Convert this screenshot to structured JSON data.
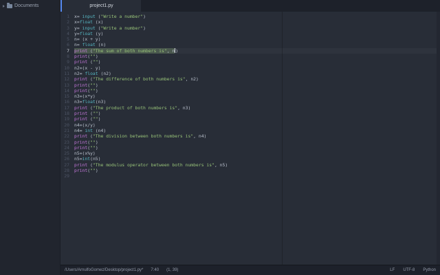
{
  "sidebar": {
    "items": [
      {
        "label": "Documents",
        "icon": "folder-icon",
        "state": "collapsed"
      }
    ]
  },
  "tabbar": {
    "tabs": [
      {
        "label": "project1.py",
        "active": true
      }
    ]
  },
  "editor": {
    "wrap_guide_column": 80,
    "active_line": 7,
    "lines": [
      {
        "num": 1,
        "tokens": [
          {
            "t": "plain",
            "s": "x= "
          },
          {
            "t": "fn",
            "s": "input"
          },
          {
            "t": "plain",
            "s": " ("
          },
          {
            "t": "str",
            "s": "\"Write a number\""
          },
          {
            "t": "plain",
            "s": ")"
          }
        ]
      },
      {
        "num": 2,
        "tokens": [
          {
            "t": "plain",
            "s": "x="
          },
          {
            "t": "fn",
            "s": "float"
          },
          {
            "t": "plain",
            "s": " (x)"
          }
        ]
      },
      {
        "num": 3,
        "tokens": [
          {
            "t": "plain",
            "s": "y= "
          },
          {
            "t": "fn",
            "s": "input"
          },
          {
            "t": "plain",
            "s": " ("
          },
          {
            "t": "str",
            "s": "\"Write a number\""
          },
          {
            "t": "plain",
            "s": ")"
          }
        ]
      },
      {
        "num": 4,
        "tokens": [
          {
            "t": "plain",
            "s": "y="
          },
          {
            "t": "fn",
            "s": "float"
          },
          {
            "t": "plain",
            "s": " (y)"
          }
        ]
      },
      {
        "num": 5,
        "tokens": [
          {
            "t": "plain",
            "s": "n= (x + y)"
          }
        ]
      },
      {
        "num": 6,
        "tokens": [
          {
            "t": "plain",
            "s": "n= "
          },
          {
            "t": "fn",
            "s": "float"
          },
          {
            "t": "plain",
            "s": " (n)"
          }
        ]
      },
      {
        "num": 7,
        "active": true,
        "tokens": [
          {
            "t": "kw",
            "s": "print",
            "sel": true
          },
          {
            "t": "plain",
            "s": " (",
            "sel": true
          },
          {
            "t": "str",
            "s": "\"The sum of both numbers is\"",
            "sel": true
          },
          {
            "t": "plain",
            "s": ", n",
            "sel": true
          },
          {
            "t": "cursor"
          },
          {
            "t": "plain",
            "s": ")"
          }
        ]
      },
      {
        "num": 8,
        "tokens": [
          {
            "t": "kw",
            "s": "print"
          },
          {
            "t": "plain",
            "s": "("
          },
          {
            "t": "str",
            "s": "\"\""
          },
          {
            "t": "plain",
            "s": ")"
          }
        ]
      },
      {
        "num": 9,
        "tokens": [
          {
            "t": "kw",
            "s": "print"
          },
          {
            "t": "plain",
            "s": " ("
          },
          {
            "t": "str",
            "s": "\"\""
          },
          {
            "t": "plain",
            "s": ")"
          }
        ]
      },
      {
        "num": 10,
        "tokens": [
          {
            "t": "plain",
            "s": "n2=(x - y)"
          }
        ]
      },
      {
        "num": 11,
        "tokens": [
          {
            "t": "plain",
            "s": "n2= "
          },
          {
            "t": "fn",
            "s": "float"
          },
          {
            "t": "plain",
            "s": " (n2)"
          }
        ]
      },
      {
        "num": 12,
        "tokens": [
          {
            "t": "kw",
            "s": "print"
          },
          {
            "t": "plain",
            "s": " ("
          },
          {
            "t": "str",
            "s": "\"The difference of both numbers is\""
          },
          {
            "t": "plain",
            "s": ", n2)"
          }
        ]
      },
      {
        "num": 13,
        "tokens": [
          {
            "t": "kw",
            "s": "print"
          },
          {
            "t": "plain",
            "s": "("
          },
          {
            "t": "str",
            "s": "\"\""
          },
          {
            "t": "plain",
            "s": ")"
          }
        ]
      },
      {
        "num": 14,
        "tokens": [
          {
            "t": "kw",
            "s": "print"
          },
          {
            "t": "plain",
            "s": "("
          },
          {
            "t": "str",
            "s": "\"\""
          },
          {
            "t": "plain",
            "s": ")"
          }
        ]
      },
      {
        "num": 15,
        "tokens": [
          {
            "t": "plain",
            "s": "n3=(x*y)"
          }
        ]
      },
      {
        "num": 16,
        "tokens": [
          {
            "t": "plain",
            "s": "n3="
          },
          {
            "t": "fn",
            "s": "float"
          },
          {
            "t": "plain",
            "s": "(n3)"
          }
        ]
      },
      {
        "num": 17,
        "tokens": [
          {
            "t": "kw",
            "s": "print"
          },
          {
            "t": "plain",
            "s": " ("
          },
          {
            "t": "str",
            "s": "\"The product of both numbers is\""
          },
          {
            "t": "plain",
            "s": ", n3)"
          }
        ]
      },
      {
        "num": 18,
        "tokens": [
          {
            "t": "kw",
            "s": "print"
          },
          {
            "t": "plain",
            "s": " ("
          },
          {
            "t": "str",
            "s": "\"\""
          },
          {
            "t": "plain",
            "s": ")"
          }
        ]
      },
      {
        "num": 19,
        "tokens": [
          {
            "t": "kw",
            "s": "print"
          },
          {
            "t": "plain",
            "s": " ("
          },
          {
            "t": "str",
            "s": "\"\""
          },
          {
            "t": "plain",
            "s": ")"
          }
        ]
      },
      {
        "num": 20,
        "tokens": [
          {
            "t": "plain",
            "s": "n4=(x/y)"
          }
        ]
      },
      {
        "num": 21,
        "tokens": [
          {
            "t": "plain",
            "s": "n4= "
          },
          {
            "t": "fn",
            "s": "int"
          },
          {
            "t": "plain",
            "s": " (n4)"
          }
        ]
      },
      {
        "num": 22,
        "tokens": [
          {
            "t": "kw",
            "s": "print"
          },
          {
            "t": "plain",
            "s": " ("
          },
          {
            "t": "str",
            "s": "\"The division between both numbers is\""
          },
          {
            "t": "plain",
            "s": ", n4)"
          }
        ]
      },
      {
        "num": 23,
        "tokens": [
          {
            "t": "kw",
            "s": "print"
          },
          {
            "t": "plain",
            "s": "("
          },
          {
            "t": "str",
            "s": "\"\""
          },
          {
            "t": "plain",
            "s": ")"
          }
        ]
      },
      {
        "num": 24,
        "tokens": [
          {
            "t": "kw",
            "s": "print"
          },
          {
            "t": "plain",
            "s": "("
          },
          {
            "t": "str",
            "s": "\"\""
          },
          {
            "t": "plain",
            "s": ")"
          }
        ]
      },
      {
        "num": 25,
        "tokens": [
          {
            "t": "plain",
            "s": "n5=(x%y)"
          }
        ]
      },
      {
        "num": 26,
        "tokens": [
          {
            "t": "plain",
            "s": "n5="
          },
          {
            "t": "fn",
            "s": "int"
          },
          {
            "t": "plain",
            "s": "(n5)"
          }
        ]
      },
      {
        "num": 27,
        "tokens": [
          {
            "t": "kw",
            "s": "print"
          },
          {
            "t": "plain",
            "s": " ("
          },
          {
            "t": "str",
            "s": "\"The modulus operator between both numbers is\""
          },
          {
            "t": "plain",
            "s": ", n5)"
          }
        ]
      },
      {
        "num": 28,
        "tokens": [
          {
            "t": "kw",
            "s": "print"
          },
          {
            "t": "plain",
            "s": "("
          },
          {
            "t": "str",
            "s": "\"\""
          },
          {
            "t": "plain",
            "s": ")"
          }
        ]
      },
      {
        "num": 29,
        "tokens": []
      }
    ]
  },
  "statusbar": {
    "file_path": "/Users/ArnulfoGomez/Desktop/project1.py*",
    "cursor_position": "7:40",
    "selection_count": "(1, 39)",
    "line_ending": "LF",
    "encoding": "UTF-8",
    "language": "Python"
  },
  "colors": {
    "accent": "#568af2",
    "editor_bg": "#282d37",
    "sidebar_bg": "#21252e",
    "tabbar_bg": "#1d212a",
    "statusbar_bg": "#1d212a",
    "keyword": "#c678dd",
    "function": "#56b6c2",
    "string": "#98c379",
    "selection_bg": "#4a584e"
  }
}
